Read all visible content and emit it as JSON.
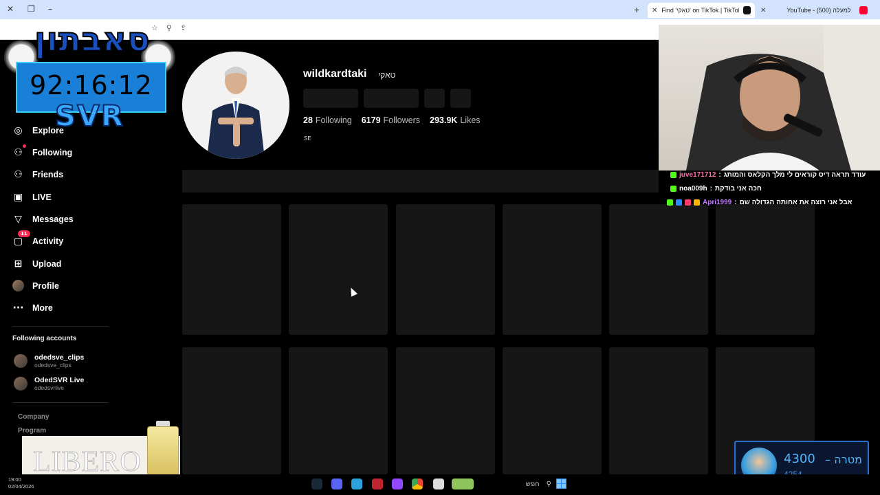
{
  "browser": {
    "tabs": [
      {
        "title": "Find 'טאקי' on TikTok | TikTok S",
        "active": true
      },
      {
        "title": "YouTube - (500) למעלה",
        "active": false
      }
    ]
  },
  "sidebar": {
    "items": [
      {
        "label": "Explore",
        "icon": "compass-icon"
      },
      {
        "label": "Following",
        "icon": "following-icon"
      },
      {
        "label": "Friends",
        "icon": "friends-icon"
      },
      {
        "label": "LIVE",
        "icon": "live-icon"
      },
      {
        "label": "Messages",
        "icon": "messages-icon"
      },
      {
        "label": "Activity",
        "icon": "activity-icon",
        "badge": "11"
      },
      {
        "label": "Upload",
        "icon": "upload-icon"
      },
      {
        "label": "Profile",
        "icon": "profile-icon"
      },
      {
        "label": "More",
        "icon": "more-icon"
      }
    ],
    "following_title": "Following accounts",
    "following_accounts": [
      {
        "name": "odedsve_clips",
        "handle": "odedsve_clips"
      },
      {
        "name": "OdedSVR Live",
        "handle": "odedsvrlive"
      }
    ],
    "footer": [
      "Company",
      "Program"
    ]
  },
  "overlay": {
    "brand": "סאבתון",
    "timer": "92:16:12",
    "svr": "SVR"
  },
  "profile": {
    "username": "wildkardtaki",
    "nickname": "טאקי",
    "following_count": "28",
    "following_label": "Following",
    "followers_count": "6179",
    "followers_label": "Followers",
    "likes_count": "293.9K",
    "likes_label": "Likes",
    "bio": "SE"
  },
  "chat": [
    {
      "user": "juve171712",
      "message": "עודד תראה דיס קוראים לי מלך הקלאס והמותג",
      "color": "#ff6fa8"
    },
    {
      "user": "noa009h",
      "message": "חכה אני בודקת",
      "color": "#ffffff"
    },
    {
      "user": "Apri1999",
      "message": "אבל אני רוצה את אחותה הגדולה שם",
      "color": "#c07bff"
    }
  ],
  "goal": {
    "label": "מטרה",
    "target": "4300",
    "current": "4254"
  },
  "ad": {
    "text": "LIBERO"
  },
  "taskbar": {
    "time": "19:00",
    "date": "02/04/2026",
    "search": "חפש"
  },
  "colors": {
    "accent": "#fe2c55",
    "timer_bg": "#1a7fd6",
    "goal_blue": "#53b5ff"
  }
}
